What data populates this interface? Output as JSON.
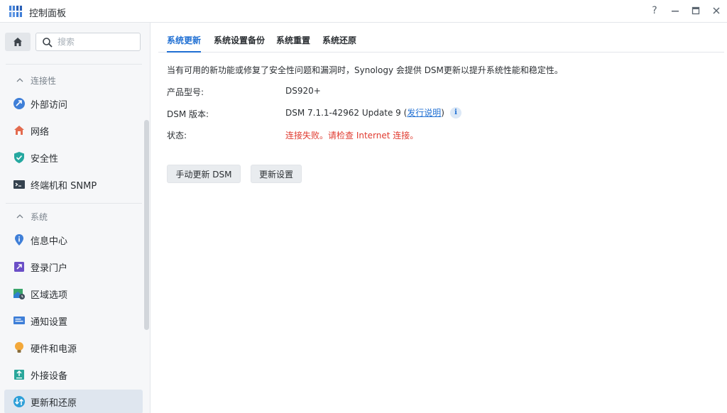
{
  "window": {
    "title": "控制面板",
    "controls": {
      "help": "?",
      "minimize": "—",
      "maximize": "□",
      "close": "✕"
    }
  },
  "sidebar": {
    "search_placeholder": "搜索",
    "sections": [
      {
        "header": "连接性",
        "items": [
          {
            "label": "外部访问",
            "icon": "external-access-icon"
          },
          {
            "label": "网络",
            "icon": "network-icon"
          },
          {
            "label": "安全性",
            "icon": "security-shield-icon"
          },
          {
            "label": "终端机和 SNMP",
            "icon": "terminal-icon"
          }
        ]
      },
      {
        "header": "系统",
        "items": [
          {
            "label": "信息中心",
            "icon": "info-center-icon"
          },
          {
            "label": "登录门户",
            "icon": "login-portal-icon"
          },
          {
            "label": "区域选项",
            "icon": "regional-options-icon"
          },
          {
            "label": "通知设置",
            "icon": "notification-icon"
          },
          {
            "label": "硬件和电源",
            "icon": "hardware-power-icon"
          },
          {
            "label": "外接设备",
            "icon": "external-devices-icon"
          },
          {
            "label": "更新和还原",
            "icon": "update-restore-icon",
            "active": true
          }
        ]
      }
    ]
  },
  "main": {
    "tabs": [
      {
        "label": "系统更新",
        "active": true
      },
      {
        "label": "系统设置备份"
      },
      {
        "label": "系统重置"
      },
      {
        "label": "系统还原"
      }
    ],
    "notice": "当有可用的新功能或修复了安全性问题和漏洞时，Synology 会提供 DSM更新以提升系统性能和稳定性。",
    "rows": {
      "model_label": "产品型号:",
      "model_value": "DS920+",
      "dsm_label": "DSM 版本:",
      "dsm_value": "DSM 7.1.1-42962 Update 9 (",
      "dsm_link": "发行说明",
      "dsm_close": ")",
      "status_label": "状态:",
      "status_value": "连接失败。请检查 Internet 连接。"
    },
    "buttons": {
      "manual_update": "手动更新 DSM",
      "update_settings": "更新设置"
    }
  },
  "colors": {
    "accent": "#1f6fd3",
    "error": "#e03b30",
    "active_bg": "#dfe6ef"
  }
}
